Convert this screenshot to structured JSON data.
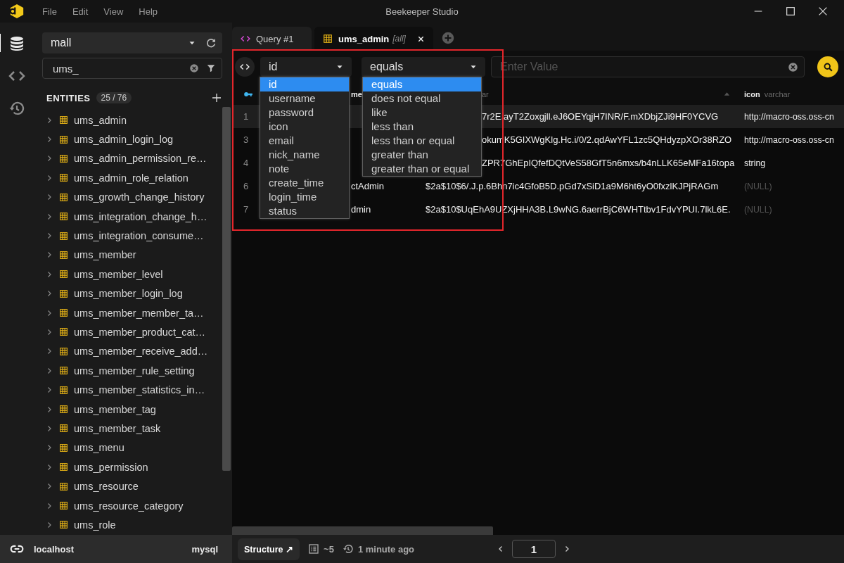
{
  "app": {
    "title": "Beekeeper Studio",
    "menu": [
      "File",
      "Edit",
      "View",
      "Help"
    ]
  },
  "activity_bar": [
    {
      "kind": "database",
      "selected": true
    },
    {
      "kind": "code",
      "selected": false
    },
    {
      "kind": "history",
      "selected": false
    }
  ],
  "sidebar": {
    "connection": "mall",
    "filter": "ums_",
    "entities_label": "ENTITIES",
    "entities_count": "25 / 76",
    "tables": [
      "ums_admin",
      "ums_admin_login_log",
      "ums_admin_permission_re…",
      "ums_admin_role_relation",
      "ums_growth_change_history",
      "ums_integration_change_h…",
      "ums_integration_consume…",
      "ums_member",
      "ums_member_level",
      "ums_member_login_log",
      "ums_member_member_ta…",
      "ums_member_product_cat…",
      "ums_member_receive_add…",
      "ums_member_rule_setting",
      "ums_member_statistics_in…",
      "ums_member_tag",
      "ums_member_task",
      "ums_menu",
      "ums_permission",
      "ums_resource",
      "ums_resource_category",
      "ums_role"
    ]
  },
  "connection_bar": {
    "host": "localhost",
    "driver": "mysql"
  },
  "tabs": [
    {
      "kind": "query",
      "label": "Query #1",
      "selected": false
    },
    {
      "kind": "table",
      "label": "ums_admin",
      "suffix": "[all]",
      "selected": true
    }
  ],
  "filter": {
    "column": "id",
    "operator": "equals",
    "placeholder": "Enter Value",
    "column_options": [
      {
        "label": "id",
        "selected": true
      },
      {
        "label": "username",
        "selected": false
      },
      {
        "label": "password",
        "selected": false
      },
      {
        "label": "icon",
        "selected": false
      },
      {
        "label": "email",
        "selected": false
      },
      {
        "label": "nick_name",
        "selected": false
      },
      {
        "label": "note",
        "selected": false
      },
      {
        "label": "create_time",
        "selected": false
      },
      {
        "label": "login_time",
        "selected": false
      },
      {
        "label": "status",
        "selected": false
      }
    ],
    "operator_options": [
      {
        "label": "equals",
        "selected": true
      },
      {
        "label": "does not equal",
        "selected": false
      },
      {
        "label": "like",
        "selected": false
      },
      {
        "label": "less than",
        "selected": false
      },
      {
        "label": "less than or equal",
        "selected": false
      },
      {
        "label": "greater than",
        "selected": false
      },
      {
        "label": "greater than or equal",
        "selected": false
      }
    ]
  },
  "table": {
    "columns": [
      {
        "kind": "key"
      },
      {
        "kind": "field",
        "name": "me"
      },
      {
        "kind": "field",
        "type": "ar",
        "sorted": true
      },
      {
        "kind": "field",
        "name": "icon",
        "type": "varchar"
      }
    ],
    "rows": [
      {
        "selected": true,
        "cells": [
          {
            "text": "1"
          },
          null,
          {
            "text": "7r2E.ayT2Zoxgjll.eJ6OEYqjH7INR/F.mXDbjZJi9HF0YCVG"
          },
          {
            "text": "http://macro-oss.oss-cn"
          }
        ]
      },
      {
        "selected": false,
        "cells": [
          {
            "text": "3"
          },
          null,
          {
            "text": "okumK5GIXWgKlg.Hc.i/0/2.qdAwYFL1zc5QHdyzpXOr38RZO"
          },
          {
            "text": "http://macro-oss.oss-cn"
          }
        ]
      },
      {
        "selected": false,
        "cells": [
          {
            "text": "4"
          },
          null,
          {
            "text": "ZPR7GhEpIQfefDQtVeS58GfT5n6mxs/b4nLLK65eMFa16topa"
          },
          {
            "text": "string"
          }
        ]
      },
      {
        "selected": false,
        "cells": [
          {
            "text": "6"
          },
          {
            "text": "ctAdmin"
          },
          {
            "text": "$2a$10$6/.J.p.6Bhn7ic4GfoB5D.pGd7xSiD1a9M6ht6yO0fxzlKJPjRAGm"
          },
          {
            "text": "(NULL)",
            "kind": "null"
          }
        ]
      },
      {
        "selected": false,
        "cells": [
          {
            "text": "7"
          },
          {
            "text": "dmin"
          },
          {
            "text": "$2a$10$UqEhA9UZXjHHA3B.L9wNG.6aerrBjC6WHTtbv1FdvYPUI.7lkL6E."
          },
          {
            "text": "(NULL)",
            "kind": "null"
          }
        ]
      }
    ]
  },
  "status_bar": {
    "structure": "Structure ↗",
    "row_count": "~5",
    "updated": "1 minute ago",
    "page": "1"
  }
}
